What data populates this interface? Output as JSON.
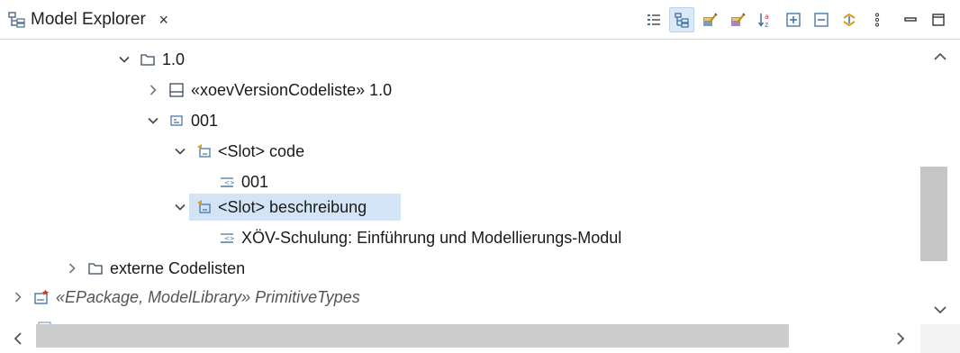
{
  "view": {
    "title": "Model Explorer",
    "close_glyph": "×",
    "icon": "model-explorer-icon"
  },
  "toolbar": {
    "buttons": [
      {
        "name": "list-view-icon",
        "pressed": false
      },
      {
        "name": "tree-view-icon",
        "pressed": true
      },
      {
        "name": "edit-model-icon",
        "pressed": false
      },
      {
        "name": "edit-diagram-icon",
        "pressed": false
      },
      {
        "name": "sort-alphabetical-icon",
        "pressed": false
      },
      {
        "name": "expand-all-icon",
        "pressed": false
      },
      {
        "name": "collapse-all-icon",
        "pressed": false
      },
      {
        "name": "link-with-editor-icon",
        "pressed": false
      },
      {
        "name": "view-menu-icon",
        "pressed": false
      },
      {
        "name": "minimize-icon",
        "pressed": false
      },
      {
        "name": "maximize-icon",
        "pressed": false
      }
    ]
  },
  "tree": {
    "nodes": [
      {
        "label": "1.0",
        "twisty": "expanded",
        "icon": "package-icon",
        "italic": false
      },
      {
        "label": "«xoevVersionCodeliste» 1.0",
        "twisty": "collapsed",
        "icon": "class-icon",
        "italic": false
      },
      {
        "label": "001",
        "twisty": "expanded",
        "icon": "instance-icon",
        "italic": false
      },
      {
        "label": "<Slot> code",
        "twisty": "expanded",
        "icon": "slot-icon",
        "italic": false
      },
      {
        "label": "001",
        "twisty": "none",
        "icon": "value-icon",
        "italic": false
      },
      {
        "label": "<Slot> beschreibung",
        "twisty": "expanded",
        "icon": "slot-icon",
        "italic": false,
        "selected": true
      },
      {
        "label": "XÖV-Schulung: Einführung und Modellierungs-Modul",
        "twisty": "none",
        "icon": "value-icon",
        "italic": false
      },
      {
        "label": "externe Codelisten",
        "twisty": "collapsed",
        "icon": "package-icon",
        "italic": false
      },
      {
        "label": "«EPackage, ModelLibrary» PrimitiveTypes",
        "twisty": "collapsed",
        "icon": "library-icon",
        "italic": true
      }
    ]
  },
  "colors": {
    "selection": "#d3e4f6",
    "scroll_thumb": "#c6c6c6",
    "toolbar_pressed": "#dbe9f7"
  }
}
